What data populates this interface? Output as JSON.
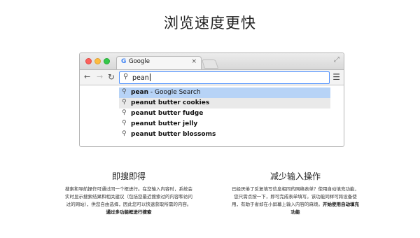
{
  "page_title": "浏览速度更快",
  "browser": {
    "tab_favicon": "G",
    "tab_title": "Google",
    "tab_close": "×",
    "omnibox_value": "pean",
    "icons": [
      "search-icon",
      "back-icon",
      "forward-icon",
      "reload-icon",
      "menu-icon",
      "fullscreen-icon"
    ],
    "suggestions": [
      {
        "text": "pean",
        "suffix": " - Google Search"
      },
      {
        "text": "peanut butter cookies",
        "suffix": ""
      },
      {
        "text": "peanut butter fudge",
        "suffix": ""
      },
      {
        "text": "peanut butter jelly",
        "suffix": ""
      },
      {
        "text": "peanut butter blossoms",
        "suffix": ""
      }
    ]
  },
  "left_section": {
    "heading": "即搜即得",
    "line1": "搜索和导航操作可通过同一个框进行。在您输入内容时，系统会",
    "line2": "实时显示搜索结果和相关建议（包括您最近搜索过的内容和访问",
    "line3": "过的网站），供您自由选择，因此您可以快速获取所需的内容。",
    "link": "通过多功能框进行搜索"
  },
  "right_section": {
    "heading": "减少输入操作",
    "line1": "已经厌倦了反复填写信息相同的网络表单？使用自动填充功能，",
    "line2": "您只需点按一下，即可完成表单填写。该功能同样可跨设备使",
    "line3": "用，有助于省却在小屏幕上输入内容的麻烦。",
    "link_part1": "开始使用自动填充",
    "link_part2": "功能"
  },
  "colors": {
    "omnibox_border": "#4d90fe",
    "selected_suggestion": "#b7d3f6",
    "hovered_suggestion": "#e9e9e9"
  }
}
